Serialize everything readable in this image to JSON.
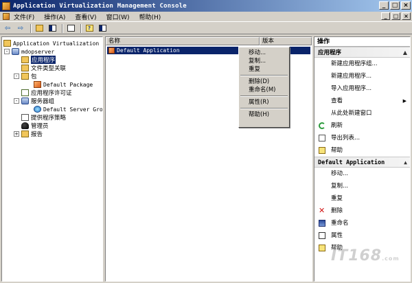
{
  "window": {
    "title": "Application Virtualization Management Console",
    "buttons": [
      "_",
      "□",
      "×"
    ]
  },
  "menubar": {
    "items": [
      "文件(F)",
      "操作(A)",
      "查看(V)",
      "窗口(W)",
      "帮助(H)"
    ],
    "mdi_buttons": [
      "_",
      "□",
      "×"
    ]
  },
  "toolbar": {
    "back": "⇦",
    "forward": "⇨"
  },
  "tree": {
    "root": "Application Virtualization 系",
    "server": "mdopserver",
    "items": {
      "applications": "应用程序",
      "file_types": "文件类型关联",
      "packages": "包",
      "default_package": "Default Package",
      "licenses": "应用程序许可证",
      "server_groups": "服务器组",
      "default_server_group": "Default Server Grou",
      "provider_policies": "提供程序策略",
      "admins": "管理员",
      "reports": "报告"
    }
  },
  "list": {
    "columns": [
      "名称",
      "版本"
    ],
    "rows": [
      {
        "name": "Default Application",
        "version": ""
      }
    ]
  },
  "context_menu": {
    "items": [
      "移动...",
      "复制...",
      "重复",
      "删除(D)",
      "重命名(M)",
      "属性(R)",
      "帮助(H)"
    ]
  },
  "actions": {
    "title": "操作",
    "section1": {
      "title": "应用程序",
      "items": [
        "新建应用程序组...",
        "新建应用程序...",
        "导入应用程序...",
        "查看",
        "从此处新建窗口",
        "刷新",
        "导出列表...",
        "帮助"
      ]
    },
    "section2": {
      "title": "Default Application",
      "items": [
        "移动...",
        "复制...",
        "重复",
        "删除",
        "重命名",
        "属性",
        "帮助"
      ]
    }
  },
  "watermark": {
    "brand": "IT168",
    "domain": ".com"
  }
}
